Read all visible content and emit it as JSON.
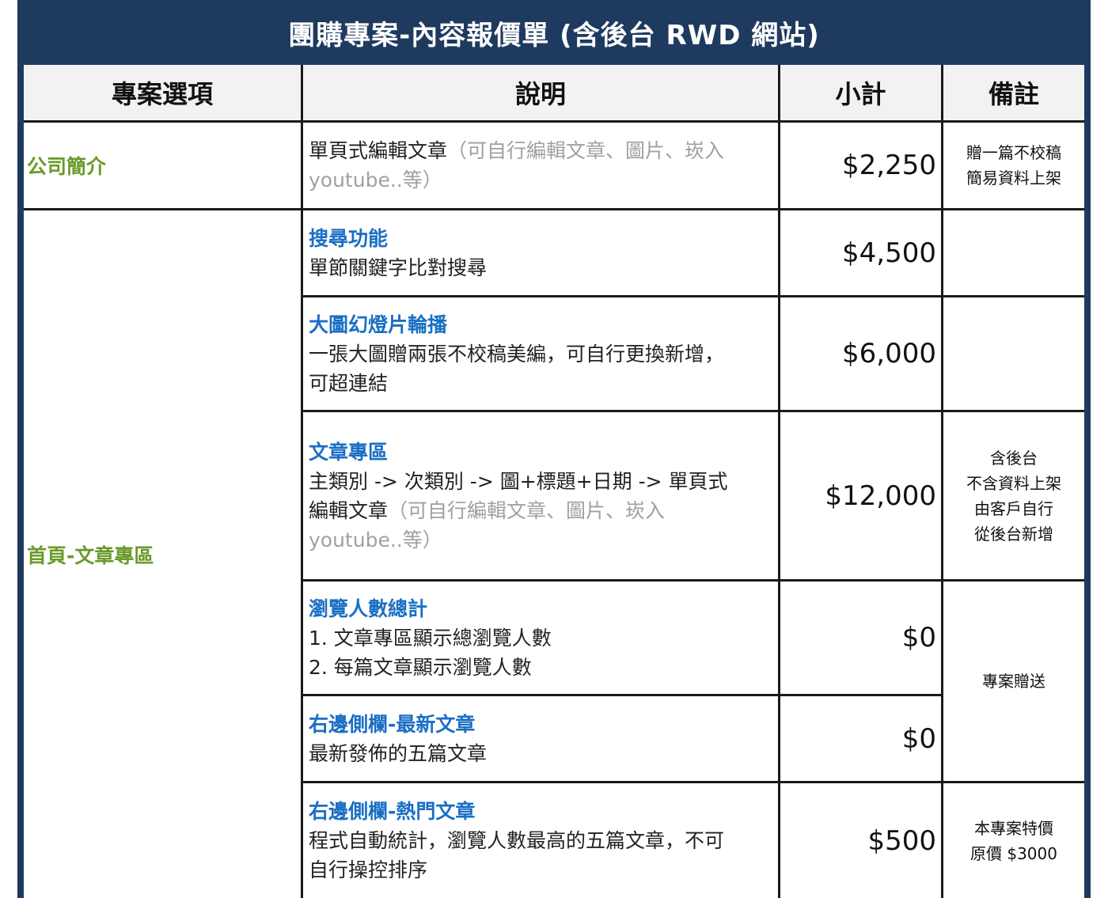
{
  "title": "團購專案-內容報價單 (含後台 RWD 網站)",
  "columns": [
    "專案選項",
    "說明",
    "小計",
    "備註"
  ],
  "options": [
    "公司簡介",
    "首頁-文章專區"
  ],
  "rows": [
    {
      "title": "",
      "desc_parts": [
        {
          "text": "單頁式編輯文章",
          "grey": false
        },
        {
          "text": "（可自行編輯文章、圖片、崁入",
          "grey": true
        },
        {
          "text": "youtube..等）",
          "grey": true
        }
      ],
      "price": "$2,250"
    },
    {
      "title": "搜尋功能",
      "desc_parts": [
        {
          "text": "單節關鍵字比對搜尋",
          "grey": false
        }
      ],
      "price": "$4,500"
    },
    {
      "title": "大圖幻燈片輪播",
      "desc_parts": [
        {
          "text": "一張大圖贈兩張不校稿美編，可自行更換新增，",
          "grey": false
        },
        {
          "text": "可超連結",
          "grey": false
        }
      ],
      "price": "$6,000"
    },
    {
      "title": "文章專區",
      "desc_parts": [
        {
          "text": "主類別 -> 次類別 -> 圖+標題+日期 -> 單頁式",
          "grey": false
        },
        {
          "text": "編輯文章",
          "grey": false
        },
        {
          "text": "（可自行編輯文章、圖片、崁入",
          "grey": true
        },
        {
          "text": "youtube..等）",
          "grey": true
        }
      ],
      "price": "$12,000"
    },
    {
      "title": "瀏覽人數總計",
      "desc_parts": [
        {
          "text": "1. 文章專區顯示總瀏覽人數",
          "grey": false
        },
        {
          "text": "2. 每篇文章顯示瀏覽人數",
          "grey": false
        }
      ],
      "price": "$0"
    },
    {
      "title": "右邊側欄-最新文章",
      "desc_parts": [
        {
          "text": "最新發佈的五篇文章",
          "grey": false
        }
      ],
      "price": "$0"
    },
    {
      "title": "右邊側欄-熱門文章",
      "desc_parts": [
        {
          "text": "程式自動統計，瀏覽人數最高的五篇文章，不可",
          "grey": false
        },
        {
          "text": "自行操控排序",
          "grey": false
        }
      ],
      "price": "$500"
    }
  ],
  "notes": {
    "company_intro": [
      "贈一篇不校稿",
      "簡易資料上架"
    ],
    "article_zone": [
      "含後台",
      "不含資料上架",
      "由客戶自行",
      "從後台新增"
    ],
    "gift": [
      "專案贈送"
    ],
    "hot_articles": [
      "本專案特價",
      "原價 $3000"
    ]
  },
  "colors": {
    "header_bg": "#1e3a5f",
    "option_text": "#6a9a2a",
    "item_title": "#1a6fc4",
    "muted_text": "#a0a0a0"
  }
}
